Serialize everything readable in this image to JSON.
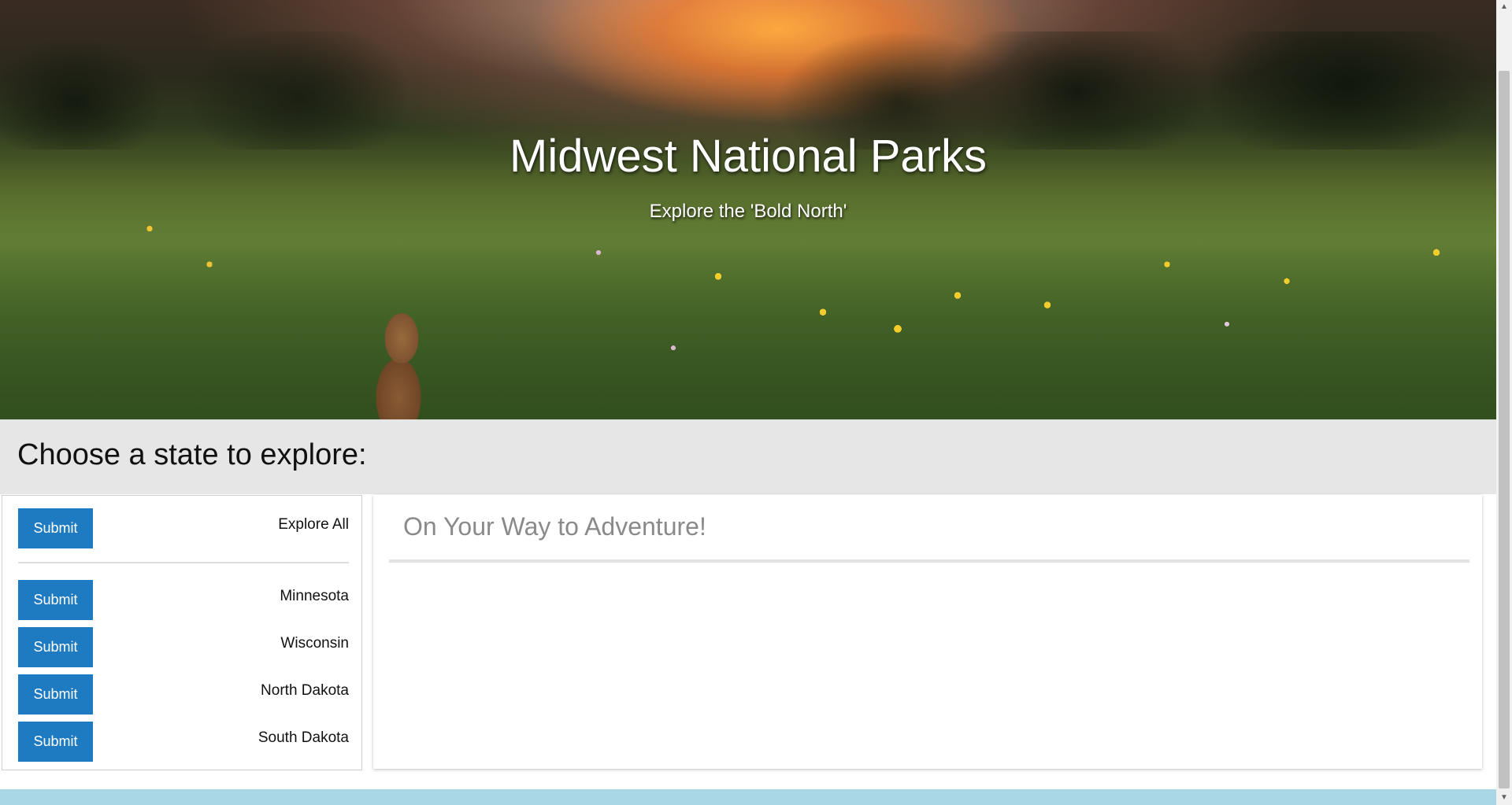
{
  "hero": {
    "title": "Midwest National Parks",
    "subtitle": "Explore the 'Bold North'"
  },
  "section": {
    "title": "Choose a state to explore:"
  },
  "states": [
    {
      "button_label": "Submit",
      "label": "Explore All"
    },
    {
      "button_label": "Submit",
      "label": "Minnesota"
    },
    {
      "button_label": "Submit",
      "label": "Wisconsin"
    },
    {
      "button_label": "Submit",
      "label": "North Dakota"
    },
    {
      "button_label": "Submit",
      "label": "South Dakota"
    }
  ],
  "results": {
    "title": "On Your Way to Adventure!"
  },
  "colors": {
    "button": "#1e7ac1",
    "section_band": "#e6e6e6",
    "footer": "#a9d7e6",
    "results_title": "#8a8a8a"
  },
  "icons": {
    "scroll_up": "scroll-up-arrow-icon",
    "scroll_down": "scroll-down-arrow-icon"
  }
}
